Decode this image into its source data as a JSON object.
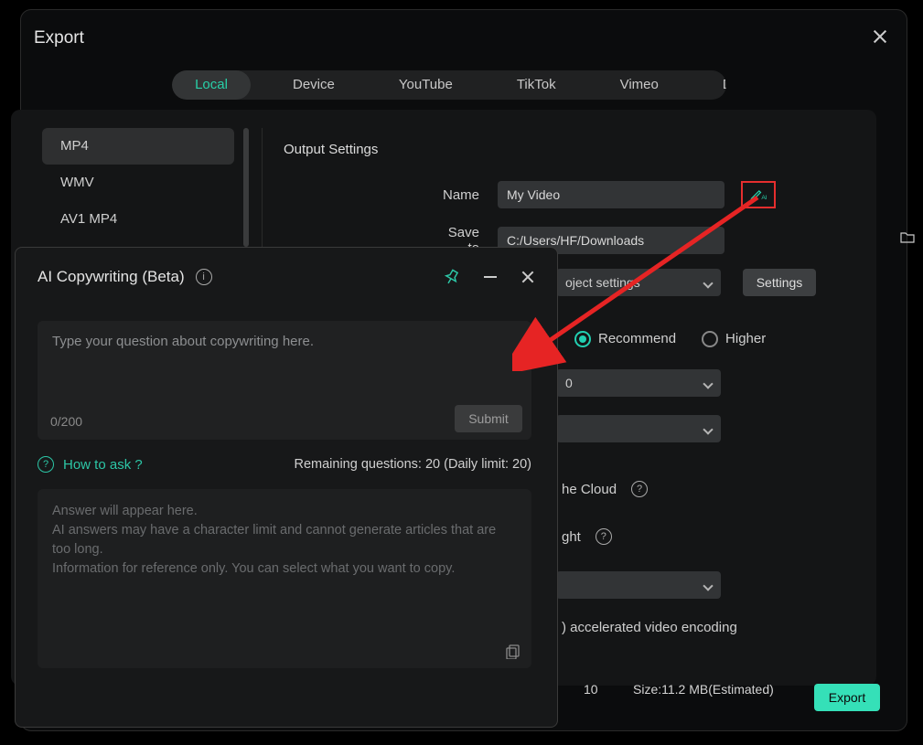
{
  "dialog": {
    "title": "Export"
  },
  "tabs": {
    "local": "Local",
    "device": "Device",
    "youtube": "YouTube",
    "tiktok": "TikTok",
    "vimeo": "Vimeo",
    "dvd": "DVD"
  },
  "formats": {
    "mp4": "MP4",
    "wmv": "WMV",
    "av1mp4": "AV1 MP4"
  },
  "settings": {
    "heading": "Output Settings",
    "name_label": "Name",
    "name_value": "My Video",
    "saveto_label": "Save to",
    "saveto_value": "C:/Users/HF/Downloads",
    "dropdown_text": "oject settings",
    "settings_btn": "Settings",
    "recommend": "Recommend",
    "higher": "Higher",
    "dd1_value": "0",
    "cloud_text": "he Cloud",
    "light_text": "ght",
    "encoding_text": ") accelerated video encoding"
  },
  "footer": {
    "ten": "10",
    "size": "Size:11.2 MB(Estimated)",
    "export_btn": "Export"
  },
  "ai": {
    "title": "AI Copywriting (Beta)",
    "placeholder": "Type your question about copywriting here.",
    "char_count": "0/200",
    "submit": "Submit",
    "howto": "How to ask ?",
    "remaining": "Remaining questions: 20 (Daily limit: 20)",
    "answer_line1": "Answer will appear here.",
    "answer_line2": "AI answers may have a character limit and cannot generate articles that are too long.",
    "answer_line3": "Information for reference only. You can select what you want to copy."
  }
}
